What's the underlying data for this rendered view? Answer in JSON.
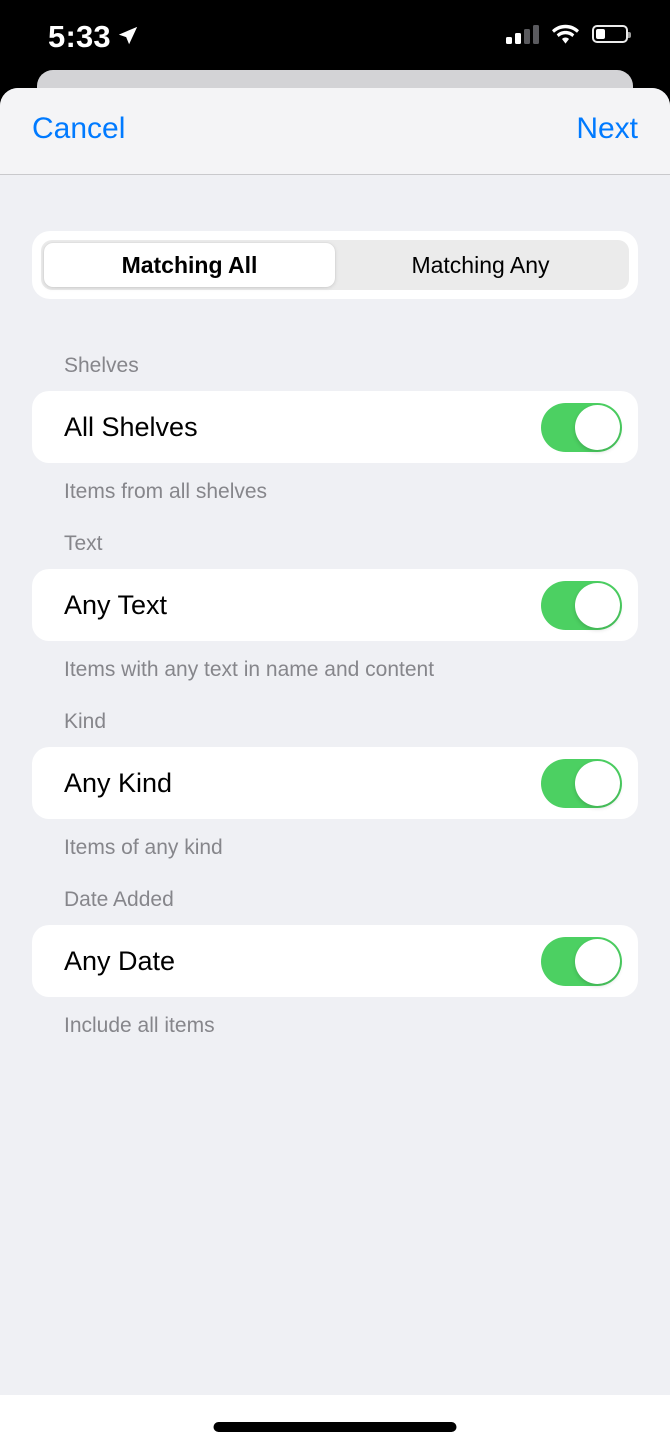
{
  "status_bar": {
    "time": "5:33",
    "location_icon": "location-arrow-icon",
    "cellular_icon": "cellular-bars-icon",
    "cellular_bars_filled": 2,
    "cellular_bars_total": 4,
    "wifi_icon": "wifi-icon",
    "battery_icon": "battery-icon",
    "battery_percent": 32
  },
  "nav_bar": {
    "cancel_label": "Cancel",
    "next_label": "Next",
    "accent_color": "#007AFF"
  },
  "segmented_control": {
    "selected_index": 0,
    "options": [
      {
        "label": "Matching All"
      },
      {
        "label": "Matching Any"
      }
    ]
  },
  "sections": [
    {
      "header": "Shelves",
      "row_label": "All Shelves",
      "toggle_on": true,
      "footer": "Items from all shelves"
    },
    {
      "header": "Text",
      "row_label": "Any Text",
      "toggle_on": true,
      "footer": "Items with any text in name and content"
    },
    {
      "header": "Kind",
      "row_label": "Any Kind",
      "toggle_on": true,
      "footer": "Items of any kind"
    },
    {
      "header": "Date Added",
      "row_label": "Any Date",
      "toggle_on": true,
      "footer": "Include all items"
    }
  ],
  "colors": {
    "toggle_on": "#4CD062",
    "sheet_background": "#EFF0F4",
    "nav_background": "#F4F4F6",
    "card_background": "#FFFFFF",
    "secondary_text": "#86868B"
  },
  "home_indicator": "home-indicator"
}
